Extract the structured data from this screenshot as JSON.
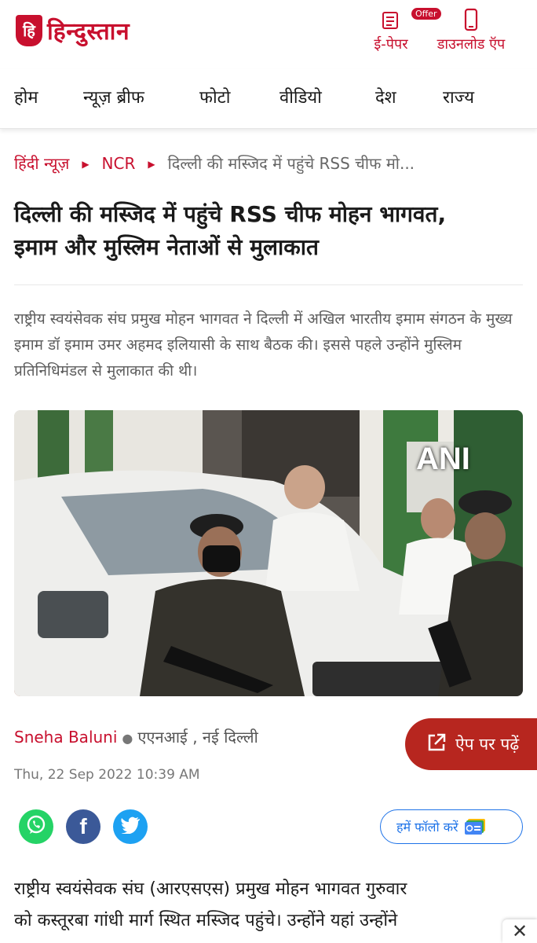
{
  "header": {
    "logo_mark": "हि",
    "logo_text": "हिन्दुस्तान",
    "epaper_label": "ई-पेपर",
    "offer_badge": "Offer",
    "download_label": "डाउनलोड ऍप"
  },
  "nav": {
    "items": [
      "होम",
      "न्यूज़ ब्रीफ",
      "फोटो",
      "वीडियो",
      "देश",
      "राज्य"
    ]
  },
  "breadcrumb": {
    "items": [
      "हिंदी न्यूज़",
      "NCR"
    ],
    "current": "दिल्ली की मस्जिद में पहुंचे RSS चीफ मो..."
  },
  "article": {
    "headline_line1": "दिल्ली की मस्जिद में पहुंचे RSS चीफ मोहन भागवत,",
    "headline_line2": "इमाम और मुस्लिम नेताओं से मुलाकात",
    "summary": "राष्ट्रीय स्वयंसेवक संघ प्रमुख मोहन भागवत ने दिल्ली में अखिल भारतीय इमाम संगठन के मुख्य इमाम डॉ इमाम उमर अहमद इलियासी के साथ बैठक की। इससे पहले उन्होंने मुस्लिम प्रतिनिधिमंडल से मुलाकात की थी।",
    "photo_watermark": "ANI",
    "author": "Sneha Baluni",
    "source": "एएनआई , नई दिल्ली",
    "date": "Thu, 22 Sep 2022 10:39 AM",
    "body_line1": "राष्ट्रीय स्वयंसेवक संघ (आरएसएस) प्रमुख मोहन भागवत गुरुवार",
    "body_line2": "को कस्तूरबा गांधी मार्ग स्थित मस्जिद पहुंचे। उन्होंने यहां उन्होंने"
  },
  "actions": {
    "app_read_label": "ऐप पर पढ़ें",
    "follow_label": "हमें फॉलो करें",
    "close_glyph": "✕"
  },
  "icons": {
    "whatsapp": "whatsapp-icon",
    "facebook": "facebook-icon",
    "twitter": "twitter-icon",
    "epaper": "newspaper-icon",
    "download": "phone-icon",
    "google_news": "google-news-icon"
  },
  "colors": {
    "brand": "#c8102e",
    "app_button": "#b7261f",
    "whatsapp": "#25d366",
    "facebook": "#3b5998",
    "twitter": "#1da1f2",
    "follow": "#1e73e8"
  }
}
